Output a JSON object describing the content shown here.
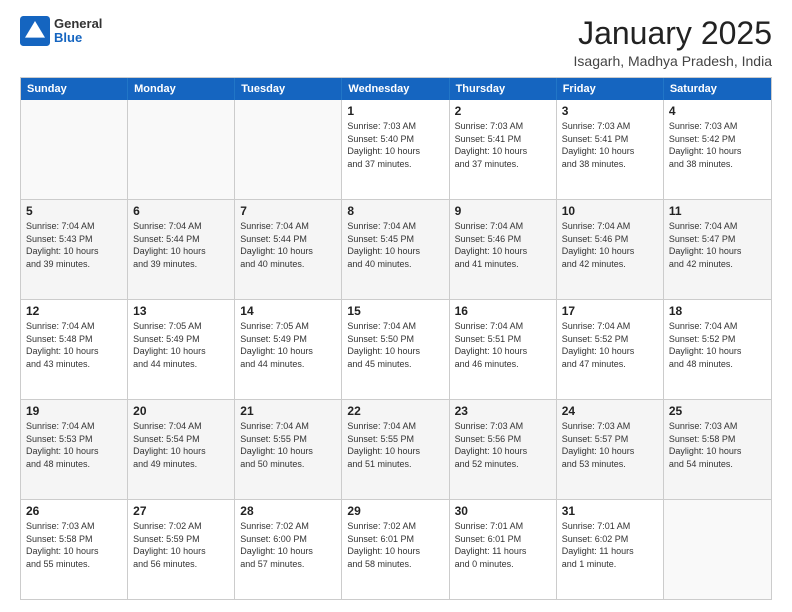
{
  "header": {
    "logo": {
      "general": "General",
      "blue": "Blue"
    },
    "title": "January 2025",
    "location": "Isagarh, Madhya Pradesh, India"
  },
  "weekdays": [
    "Sunday",
    "Monday",
    "Tuesday",
    "Wednesday",
    "Thursday",
    "Friday",
    "Saturday"
  ],
  "rows": [
    {
      "cells": [
        {
          "day": "",
          "info": "",
          "empty": true
        },
        {
          "day": "",
          "info": "",
          "empty": true
        },
        {
          "day": "",
          "info": "",
          "empty": true
        },
        {
          "day": "1",
          "info": "Sunrise: 7:03 AM\nSunset: 5:40 PM\nDaylight: 10 hours\nand 37 minutes."
        },
        {
          "day": "2",
          "info": "Sunrise: 7:03 AM\nSunset: 5:41 PM\nDaylight: 10 hours\nand 37 minutes."
        },
        {
          "day": "3",
          "info": "Sunrise: 7:03 AM\nSunset: 5:41 PM\nDaylight: 10 hours\nand 38 minutes."
        },
        {
          "day": "4",
          "info": "Sunrise: 7:03 AM\nSunset: 5:42 PM\nDaylight: 10 hours\nand 38 minutes."
        }
      ]
    },
    {
      "alt": true,
      "cells": [
        {
          "day": "5",
          "info": "Sunrise: 7:04 AM\nSunset: 5:43 PM\nDaylight: 10 hours\nand 39 minutes."
        },
        {
          "day": "6",
          "info": "Sunrise: 7:04 AM\nSunset: 5:44 PM\nDaylight: 10 hours\nand 39 minutes."
        },
        {
          "day": "7",
          "info": "Sunrise: 7:04 AM\nSunset: 5:44 PM\nDaylight: 10 hours\nand 40 minutes."
        },
        {
          "day": "8",
          "info": "Sunrise: 7:04 AM\nSunset: 5:45 PM\nDaylight: 10 hours\nand 40 minutes."
        },
        {
          "day": "9",
          "info": "Sunrise: 7:04 AM\nSunset: 5:46 PM\nDaylight: 10 hours\nand 41 minutes."
        },
        {
          "day": "10",
          "info": "Sunrise: 7:04 AM\nSunset: 5:46 PM\nDaylight: 10 hours\nand 42 minutes."
        },
        {
          "day": "11",
          "info": "Sunrise: 7:04 AM\nSunset: 5:47 PM\nDaylight: 10 hours\nand 42 minutes."
        }
      ]
    },
    {
      "cells": [
        {
          "day": "12",
          "info": "Sunrise: 7:04 AM\nSunset: 5:48 PM\nDaylight: 10 hours\nand 43 minutes."
        },
        {
          "day": "13",
          "info": "Sunrise: 7:05 AM\nSunset: 5:49 PM\nDaylight: 10 hours\nand 44 minutes."
        },
        {
          "day": "14",
          "info": "Sunrise: 7:05 AM\nSunset: 5:49 PM\nDaylight: 10 hours\nand 44 minutes."
        },
        {
          "day": "15",
          "info": "Sunrise: 7:04 AM\nSunset: 5:50 PM\nDaylight: 10 hours\nand 45 minutes."
        },
        {
          "day": "16",
          "info": "Sunrise: 7:04 AM\nSunset: 5:51 PM\nDaylight: 10 hours\nand 46 minutes."
        },
        {
          "day": "17",
          "info": "Sunrise: 7:04 AM\nSunset: 5:52 PM\nDaylight: 10 hours\nand 47 minutes."
        },
        {
          "day": "18",
          "info": "Sunrise: 7:04 AM\nSunset: 5:52 PM\nDaylight: 10 hours\nand 48 minutes."
        }
      ]
    },
    {
      "alt": true,
      "cells": [
        {
          "day": "19",
          "info": "Sunrise: 7:04 AM\nSunset: 5:53 PM\nDaylight: 10 hours\nand 48 minutes."
        },
        {
          "day": "20",
          "info": "Sunrise: 7:04 AM\nSunset: 5:54 PM\nDaylight: 10 hours\nand 49 minutes."
        },
        {
          "day": "21",
          "info": "Sunrise: 7:04 AM\nSunset: 5:55 PM\nDaylight: 10 hours\nand 50 minutes."
        },
        {
          "day": "22",
          "info": "Sunrise: 7:04 AM\nSunset: 5:55 PM\nDaylight: 10 hours\nand 51 minutes."
        },
        {
          "day": "23",
          "info": "Sunrise: 7:03 AM\nSunset: 5:56 PM\nDaylight: 10 hours\nand 52 minutes."
        },
        {
          "day": "24",
          "info": "Sunrise: 7:03 AM\nSunset: 5:57 PM\nDaylight: 10 hours\nand 53 minutes."
        },
        {
          "day": "25",
          "info": "Sunrise: 7:03 AM\nSunset: 5:58 PM\nDaylight: 10 hours\nand 54 minutes."
        }
      ]
    },
    {
      "cells": [
        {
          "day": "26",
          "info": "Sunrise: 7:03 AM\nSunset: 5:58 PM\nDaylight: 10 hours\nand 55 minutes."
        },
        {
          "day": "27",
          "info": "Sunrise: 7:02 AM\nSunset: 5:59 PM\nDaylight: 10 hours\nand 56 minutes."
        },
        {
          "day": "28",
          "info": "Sunrise: 7:02 AM\nSunset: 6:00 PM\nDaylight: 10 hours\nand 57 minutes."
        },
        {
          "day": "29",
          "info": "Sunrise: 7:02 AM\nSunset: 6:01 PM\nDaylight: 10 hours\nand 58 minutes."
        },
        {
          "day": "30",
          "info": "Sunrise: 7:01 AM\nSunset: 6:01 PM\nDaylight: 11 hours\nand 0 minutes."
        },
        {
          "day": "31",
          "info": "Sunrise: 7:01 AM\nSunset: 6:02 PM\nDaylight: 11 hours\nand 1 minute."
        },
        {
          "day": "",
          "info": "",
          "empty": true
        }
      ]
    }
  ]
}
